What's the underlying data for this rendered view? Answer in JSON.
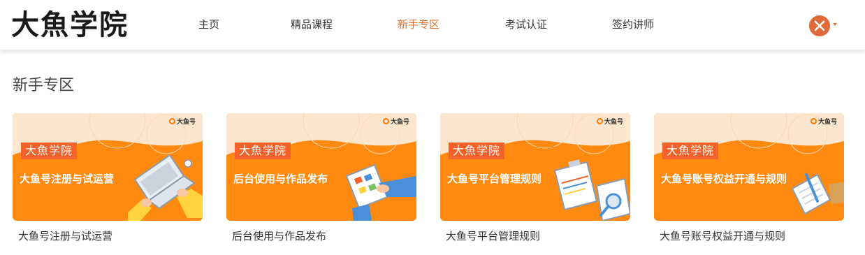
{
  "header": {
    "logo": "大魚学院",
    "nav": [
      {
        "label": "主页",
        "active": false
      },
      {
        "label": "精品课程",
        "active": false
      },
      {
        "label": "新手专区",
        "active": true
      },
      {
        "label": "考试认证",
        "active": false
      },
      {
        "label": "签约讲师",
        "active": false
      }
    ],
    "accent_color": "#e8712b"
  },
  "section": {
    "title": "新手专区"
  },
  "cards": [
    {
      "tag": "大魚学院",
      "brand": "大鱼号",
      "banner_title": "大鱼号注册与试运营",
      "caption": "大鱼号注册与试运营",
      "illustration": "laptop-hands-icon"
    },
    {
      "tag": "大魚学院",
      "brand": "大鱼号",
      "banner_title": "后台使用与作品发布",
      "caption": "后台使用与作品发布",
      "illustration": "tablet-hand-icon"
    },
    {
      "tag": "大魚学院",
      "brand": "大鱼号",
      "banner_title": "大鱼号平台管理规则",
      "caption": "大鱼号平台管理规则",
      "illustration": "clipboard-magnifier-icon"
    },
    {
      "tag": "大魚学院",
      "brand": "大鱼号",
      "banner_title": "大鱼号账号权益开通与规则",
      "caption": "大鱼号账号权益开通与规则",
      "illustration": "document-pencil-icon"
    }
  ],
  "colors": {
    "banner_orange": "#ff8a0f",
    "tag_red": "#f2622a",
    "banner_top": "#fde6cf"
  }
}
